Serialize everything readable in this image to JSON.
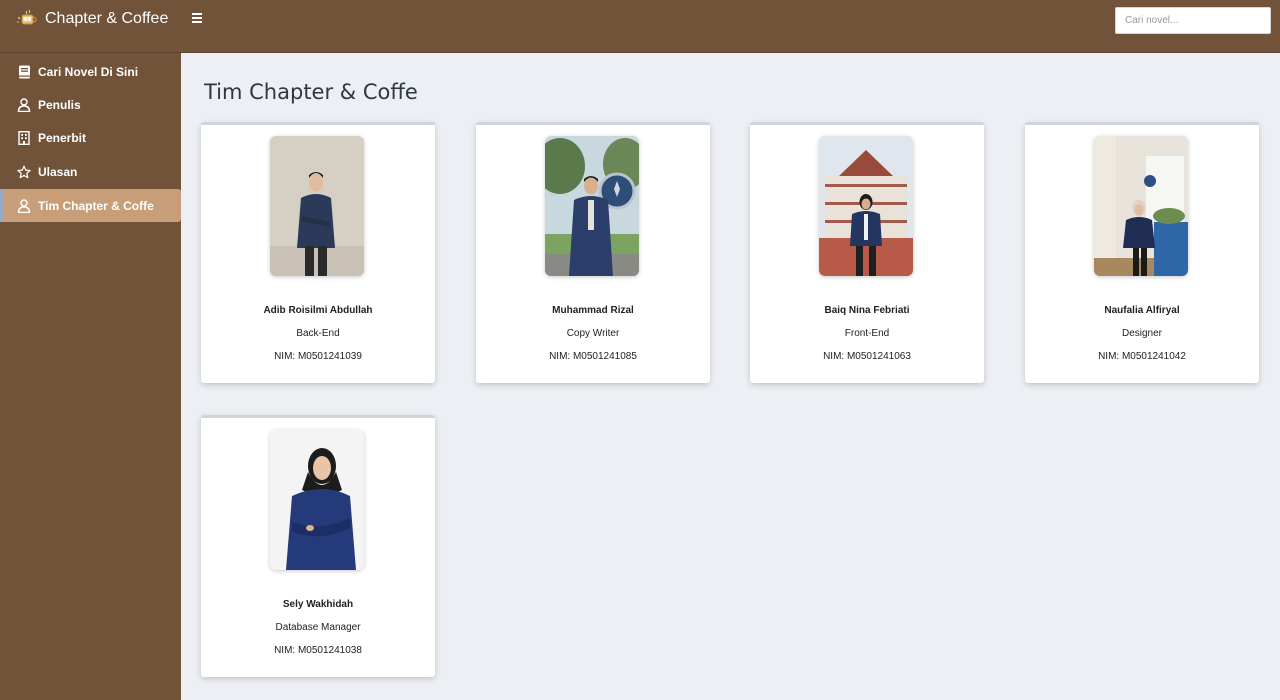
{
  "header": {
    "brand_name": "Chapter & Coffee",
    "logo_icon": "coffee-book-logo",
    "menu_icon": "hamburger-icon",
    "search_placeholder": "Cari novel..."
  },
  "sidebar": {
    "items": [
      {
        "label": "Cari Novel Di Sini",
        "icon": "book-icon",
        "active": false
      },
      {
        "label": "Penulis",
        "icon": "user-icon",
        "active": false
      },
      {
        "label": "Penerbit",
        "icon": "building-icon",
        "active": false
      },
      {
        "label": "Ulasan",
        "icon": "star-icon",
        "active": false
      },
      {
        "label": "Tim Chapter & Coffe",
        "icon": "user-icon",
        "active": true
      }
    ]
  },
  "main": {
    "title": "Tim Chapter & Coffe",
    "nim_label": "NIM:",
    "members": [
      {
        "name": "Adib Roisilmi Abdullah",
        "role": "Back-End",
        "nim": "M0501241039"
      },
      {
        "name": "Muhammad Rizal",
        "role": "Copy Writer",
        "nim": "M0501241085"
      },
      {
        "name": "Baiq Nina Febriati",
        "role": "Front-End",
        "nim": "M0501241063"
      },
      {
        "name": "Naufalia Alfiryal",
        "role": "Designer",
        "nim": "M0501241042"
      },
      {
        "name": "Sely Wakhidah",
        "role": "Database Manager",
        "nim": "M0501241038"
      }
    ]
  },
  "colors": {
    "brand_brown": "#705339",
    "active_item": "#c79e78",
    "page_background": "#eceff3"
  }
}
